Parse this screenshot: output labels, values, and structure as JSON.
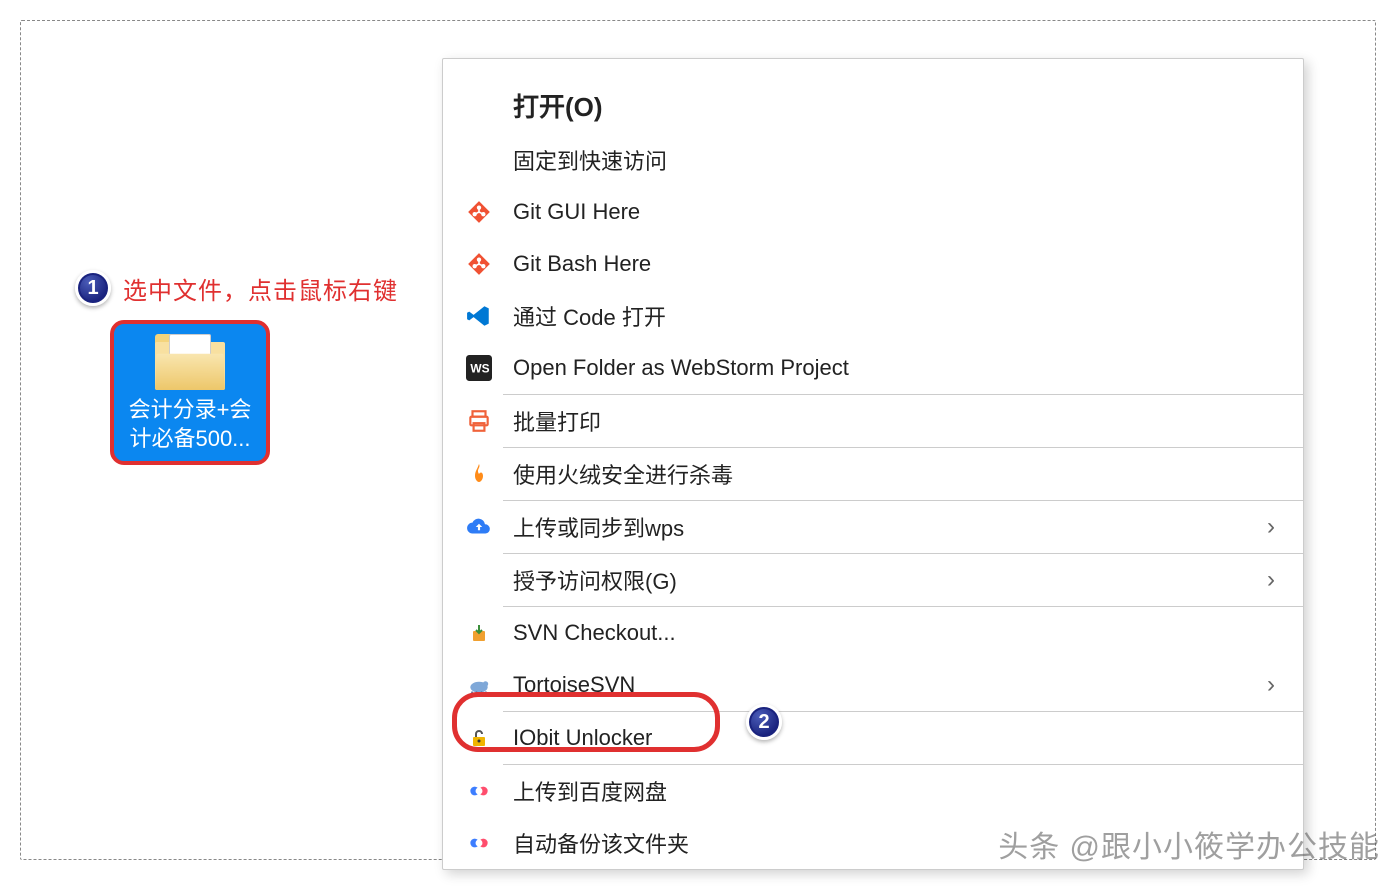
{
  "annotation1": {
    "badge": "1",
    "text": "选中文件，点击鼠标右键"
  },
  "folder": {
    "label_line1": "会计分录+会",
    "label_line2": "计必备500..."
  },
  "badge2": "2",
  "menu": {
    "open": "打开(O)",
    "pin": "固定到快速访问",
    "git_gui": "Git GUI Here",
    "git_bash": "Git Bash Here",
    "vscode": "通过 Code 打开",
    "webstorm": "Open Folder as WebStorm Project",
    "batch_print": "批量打印",
    "huorong": "使用火绒安全进行杀毒",
    "wps_upload": "上传或同步到wps",
    "access": "授予访问权限(G)",
    "svn_checkout": "SVN Checkout...",
    "tortoise": "TortoiseSVN",
    "iobit": "IObit Unlocker",
    "baidu": "上传到百度网盘",
    "baidu_backup": "自动备份该文件夹"
  },
  "watermark": "头条 @跟小小筱学办公技能"
}
